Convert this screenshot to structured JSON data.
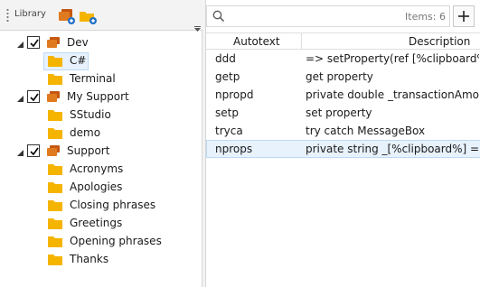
{
  "library": {
    "label": "Library",
    "tree": [
      {
        "label": "Dev",
        "kind": "group",
        "checked": true,
        "expanded": true
      },
      {
        "label": "C#",
        "kind": "folder",
        "selected": true
      },
      {
        "label": "Terminal",
        "kind": "folder"
      },
      {
        "label": "My Support",
        "kind": "group",
        "checked": true,
        "expanded": true
      },
      {
        "label": "SStudio",
        "kind": "folder"
      },
      {
        "label": "demo",
        "kind": "folder"
      },
      {
        "label": "Support",
        "kind": "group",
        "checked": true,
        "expanded": true
      },
      {
        "label": "Acronyms",
        "kind": "folder"
      },
      {
        "label": "Apologies",
        "kind": "folder"
      },
      {
        "label": "Closing phrases",
        "kind": "folder"
      },
      {
        "label": "Greetings",
        "kind": "folder"
      },
      {
        "label": "Opening phrases",
        "kind": "folder"
      },
      {
        "label": "Thanks",
        "kind": "folder"
      }
    ]
  },
  "search": {
    "value": "",
    "placeholder": "",
    "items_count": "Items: 6"
  },
  "table": {
    "columns": [
      "Autotext",
      "Description"
    ],
    "rows": [
      {
        "autotext": "ddd",
        "description": "=> setProperty(ref [%clipboard%],",
        "selected": false
      },
      {
        "autotext": "getp",
        "description": "get property",
        "selected": false
      },
      {
        "autotext": "npropd",
        "description": "private double _transactionAmoun",
        "selected": false
      },
      {
        "autotext": "setp",
        "description": "set property",
        "selected": false
      },
      {
        "autotext": "tryca",
        "description": "try catch MessageBox",
        "selected": false
      },
      {
        "autotext": "nprops",
        "description": "private string _[%clipboard%] = \"\";",
        "selected": true
      }
    ]
  },
  "colors": {
    "folder": "#f5b400",
    "group_front": "#e07a1f",
    "group_back": "#c5570f",
    "plus_badge": "#1f6fc8",
    "selection": "#e8f2fc"
  }
}
